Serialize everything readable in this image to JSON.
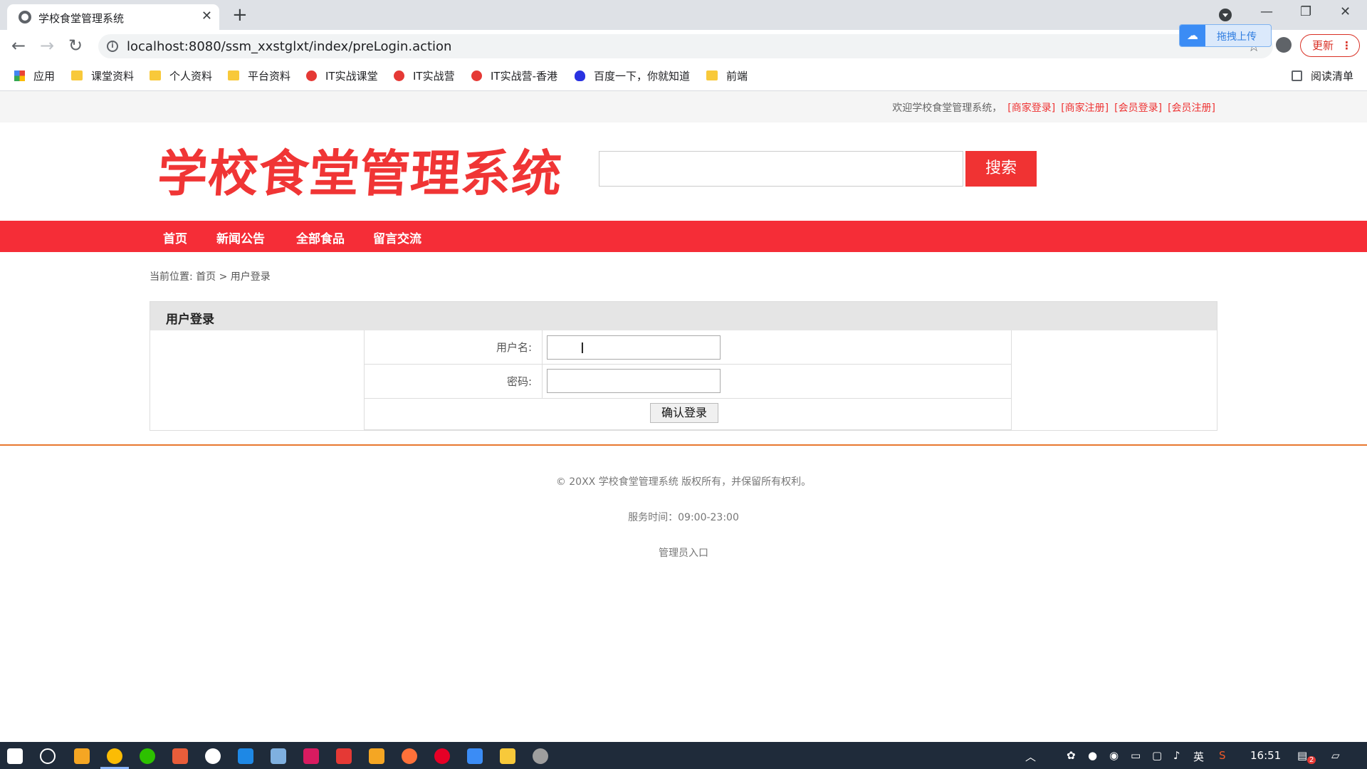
{
  "browser": {
    "tab_title": "学校食堂管理系统",
    "url": "localhost:8080/ssm_xxstglxt/index/preLogin.action",
    "baidu_upload_label": "拖拽上传",
    "update_label": "更新",
    "bookmarks": [
      "应用",
      "课堂资料",
      "个人资料",
      "平台资料",
      "IT实战课堂",
      "IT实战营",
      "IT实战营-香港",
      "百度一下，你就知道",
      "前端"
    ],
    "reading_list": "阅读清单"
  },
  "header": {
    "welcome": "欢迎学校食堂管理系统，",
    "links": [
      "[商家登录]",
      "[商家注册]",
      "[会员登录]",
      "[会员注册]"
    ],
    "logo": "学校食堂管理系统",
    "search_button": "搜索"
  },
  "nav": [
    "首页",
    "新闻公告",
    "全部食品",
    "留言交流"
  ],
  "breadcrumb": "当前位置: 首页 > 用户登录",
  "login": {
    "title": "用户登录",
    "username_label": "用户名:",
    "password_label": "密码:",
    "submit": "确认登录"
  },
  "footer": {
    "copyright": "© 20XX 学校食堂管理系统 版权所有，并保留所有权利。",
    "service_time": "服务时间：09:00-23:00",
    "admin_link": "管理员入口"
  },
  "taskbar": {
    "ime": "英",
    "clock": "16:51",
    "notif_count": "2"
  },
  "colors": {
    "brand_red": "#f52d37",
    "footer_line": "#e8772e"
  }
}
